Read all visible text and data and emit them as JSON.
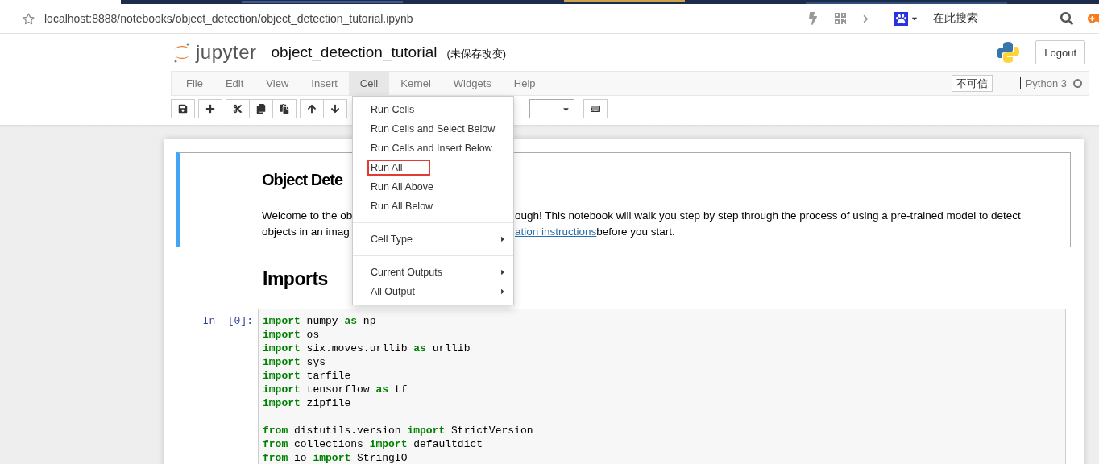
{
  "browser": {
    "url": "localhost:8888/notebooks/object_detection/object_detection_tutorial.ipynb",
    "search_placeholder": "在此搜索"
  },
  "header": {
    "logo_text": "jupyter",
    "notebook_name": "object_detection_tutorial",
    "save_status": "(未保存改变)",
    "logout": "Logout"
  },
  "menubar": {
    "items": [
      {
        "label": "File",
        "selected": false
      },
      {
        "label": "Edit",
        "selected": false
      },
      {
        "label": "View",
        "selected": false
      },
      {
        "label": "Insert",
        "selected": false
      },
      {
        "label": "Cell",
        "selected": true
      },
      {
        "label": "Kernel",
        "selected": false
      },
      {
        "label": "Widgets",
        "selected": false
      },
      {
        "label": "Help",
        "selected": false
      }
    ],
    "trust": "不可信",
    "kernel": "Python 3"
  },
  "cell_menu": [
    {
      "kind": "item",
      "label": "Run Cells",
      "highlighted": false
    },
    {
      "kind": "item",
      "label": "Run Cells and Select Below",
      "highlighted": false
    },
    {
      "kind": "item",
      "label": "Run Cells and Insert Below",
      "highlighted": false
    },
    {
      "kind": "item",
      "label": "Run All",
      "highlighted": true
    },
    {
      "kind": "item",
      "label": "Run All Above",
      "highlighted": false
    },
    {
      "kind": "item",
      "label": "Run All Below",
      "highlighted": false
    },
    {
      "kind": "divider"
    },
    {
      "kind": "submenu",
      "label": "Cell Type",
      "highlighted": false
    },
    {
      "kind": "divider"
    },
    {
      "kind": "submenu",
      "label": "Current Outputs",
      "highlighted": false
    },
    {
      "kind": "submenu",
      "label": "All Output",
      "highlighted": false
    }
  ],
  "markdown_cell": {
    "heading": "Object Dete",
    "lines": [
      {
        "left": "Welcome to the ob",
        "right": "ough! This notebook will walk you step by step through the process of using a pre-trained model to detect"
      },
      {
        "left": "objects in an imag",
        "link": "ation instructions",
        "right": " before you start."
      }
    ]
  },
  "section_heading": "Imports",
  "code_cell": {
    "prompt": "In  [0]:",
    "lines": [
      [
        {
          "kind": "kw",
          "text": "import"
        },
        {
          "kind": "plain",
          "text": " numpy "
        },
        {
          "kind": "kw",
          "text": "as"
        },
        {
          "kind": "plain",
          "text": " np"
        }
      ],
      [
        {
          "kind": "kw",
          "text": "import"
        },
        {
          "kind": "plain",
          "text": " os"
        }
      ],
      [
        {
          "kind": "kw",
          "text": "import"
        },
        {
          "kind": "plain",
          "text": " six.moves.urllib "
        },
        {
          "kind": "kw",
          "text": "as"
        },
        {
          "kind": "plain",
          "text": " urllib"
        }
      ],
      [
        {
          "kind": "kw",
          "text": "import"
        },
        {
          "kind": "plain",
          "text": " sys"
        }
      ],
      [
        {
          "kind": "kw",
          "text": "import"
        },
        {
          "kind": "plain",
          "text": " tarfile"
        }
      ],
      [
        {
          "kind": "kw",
          "text": "import"
        },
        {
          "kind": "plain",
          "text": " tensorflow "
        },
        {
          "kind": "kw",
          "text": "as"
        },
        {
          "kind": "plain",
          "text": " tf"
        }
      ],
      [
        {
          "kind": "kw",
          "text": "import"
        },
        {
          "kind": "plain",
          "text": " zipfile"
        }
      ],
      {
        "kind": "blank"
      },
      [
        {
          "kind": "kw",
          "text": "from"
        },
        {
          "kind": "plain",
          "text": " distutils.version "
        },
        {
          "kind": "kw",
          "text": "import"
        },
        {
          "kind": "plain",
          "text": " StrictVersion"
        }
      ],
      [
        {
          "kind": "kw",
          "text": "from"
        },
        {
          "kind": "plain",
          "text": " collections "
        },
        {
          "kind": "kw",
          "text": "import"
        },
        {
          "kind": "plain",
          "text": " defaultdict"
        }
      ],
      [
        {
          "kind": "kw",
          "text": "from"
        },
        {
          "kind": "plain",
          "text": " io "
        },
        {
          "kind": "kw",
          "text": "import"
        },
        {
          "kind": "plain",
          "text": " StringIO"
        }
      ]
    ]
  }
}
